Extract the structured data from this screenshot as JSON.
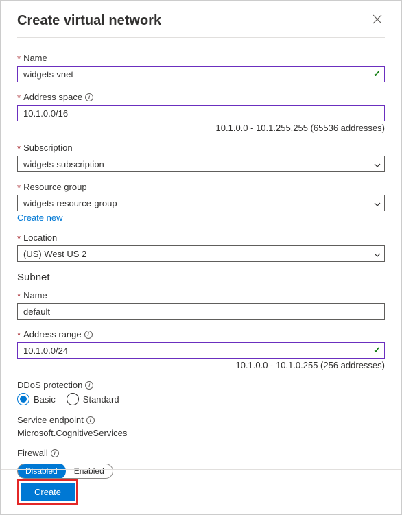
{
  "header": {
    "title": "Create virtual network"
  },
  "fields": {
    "name": {
      "label": "Name",
      "value": "widgets-vnet"
    },
    "address_space": {
      "label": "Address space",
      "value": "10.1.0.0/16",
      "hint": "10.1.0.0 - 10.1.255.255 (65536 addresses)"
    },
    "subscription": {
      "label": "Subscription",
      "value": "widgets-subscription"
    },
    "resource_group": {
      "label": "Resource group",
      "value": "widgets-resource-group",
      "create_new": "Create new"
    },
    "location": {
      "label": "Location",
      "value": "(US) West US 2"
    }
  },
  "subnet": {
    "heading": "Subnet",
    "name": {
      "label": "Name",
      "value": "default"
    },
    "address_range": {
      "label": "Address range",
      "value": "10.1.0.0/24",
      "hint": "10.1.0.0 - 10.1.0.255 (256 addresses)"
    }
  },
  "ddos": {
    "label": "DDoS protection",
    "options": {
      "basic": "Basic",
      "standard": "Standard"
    },
    "selected": "basic"
  },
  "service_endpoint": {
    "label": "Service endpoint",
    "value": "Microsoft.CognitiveServices"
  },
  "firewall": {
    "label": "Firewall",
    "options": {
      "disabled": "Disabled",
      "enabled": "Enabled"
    },
    "selected": "disabled"
  },
  "footer": {
    "create": "Create"
  }
}
